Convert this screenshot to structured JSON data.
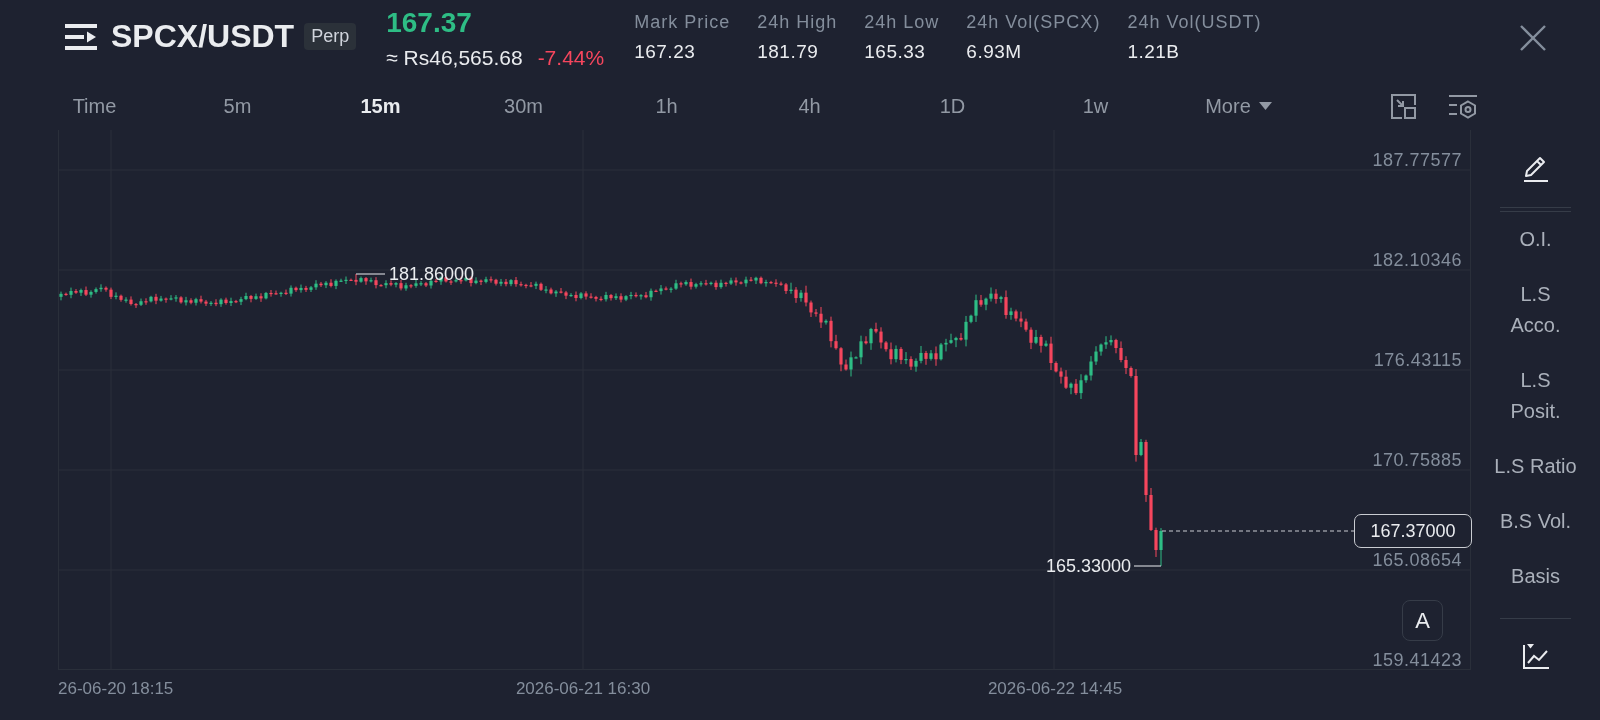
{
  "header": {
    "symbol": "SPCX/USDT",
    "contract_badge": "Perp",
    "last_price": "167.37",
    "last_price_rising": true,
    "local_price": "≈ Rs46,565.68",
    "change": "-7.44%",
    "change_rising": false,
    "stats": [
      {
        "label": "Mark Price",
        "value": "167.23"
      },
      {
        "label": "24h High",
        "value": "181.79"
      },
      {
        "label": "24h Low",
        "value": "165.33"
      },
      {
        "label": "24h Vol(SPCX)",
        "value": "6.93M"
      },
      {
        "label": "24h Vol(USDT)",
        "value": "1.21B"
      }
    ]
  },
  "intervals": [
    {
      "label": "Time",
      "kind": "interval",
      "selected": false
    },
    {
      "label": "5m",
      "kind": "interval",
      "selected": false
    },
    {
      "label": "15m",
      "kind": "interval",
      "selected": true
    },
    {
      "label": "30m",
      "kind": "interval",
      "selected": false
    },
    {
      "label": "1h",
      "kind": "interval",
      "selected": false
    },
    {
      "label": "4h",
      "kind": "interval",
      "selected": false
    },
    {
      "label": "1D",
      "kind": "interval",
      "selected": false
    },
    {
      "label": "1w",
      "kind": "interval",
      "selected": false
    },
    {
      "label": "More",
      "kind": "dropdown",
      "selected": false
    }
  ],
  "chart": {
    "price_ticks": [
      "187.77577",
      "182.10346",
      "176.43115",
      "170.75885",
      "165.08654",
      "159.41423"
    ],
    "time_ticks": [
      "26-06-20 18:15",
      "2026-06-21 16:30",
      "2026-06-22 14:45"
    ],
    "high_marker": "181.86000",
    "low_marker": "165.33000",
    "last_price_tag": "167.37000",
    "scale_button": "A"
  },
  "indicators": [
    {
      "lines": [
        "O.I."
      ]
    },
    {
      "lines": [
        "L.S",
        "Acco."
      ]
    },
    {
      "lines": [
        "L.S",
        "Posit."
      ]
    },
    {
      "lines": [
        "L.S Ratio"
      ]
    },
    {
      "lines": [
        "B.S Vol."
      ]
    },
    {
      "lines": [
        "Basis"
      ]
    }
  ]
}
